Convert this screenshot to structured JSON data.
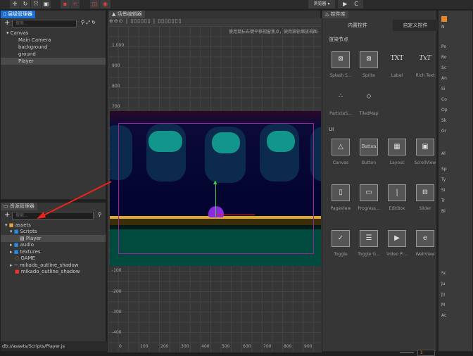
{
  "toolbar": {
    "tools": [
      "move-icon",
      "rotate-icon",
      "scale-icon",
      "rect-icon"
    ],
    "preview_target": "浏览器 ▾",
    "play": "▶",
    "refresh": "C"
  },
  "hierarchy": {
    "title": "层级管理器",
    "search_placeholder": "搜索...",
    "items": [
      {
        "label": "Canvas",
        "depth": 0,
        "expanded": true
      },
      {
        "label": "Main Camera",
        "depth": 1
      },
      {
        "label": "background",
        "depth": 1
      },
      {
        "label": "ground",
        "depth": 1
      },
      {
        "label": "Player",
        "depth": 1,
        "selected": true
      }
    ]
  },
  "assets": {
    "title": "资源管理器",
    "search_placeholder": "搜索...",
    "items": [
      {
        "label": "assets",
        "icon": "db-icon"
      },
      {
        "label": "Scripts",
        "icon": "folder-icon"
      },
      {
        "label": "Player",
        "icon": "js-icon",
        "selected": true
      },
      {
        "label": "audio",
        "icon": "folder-icon"
      },
      {
        "label": "textures",
        "icon": "folder-icon"
      },
      {
        "label": "GAME",
        "icon": "scene-icon"
      },
      {
        "label": "mikado_outline_shadow",
        "icon": "font-icon"
      },
      {
        "label": "mikado_outline_shadow",
        "icon": "image-icon"
      }
    ],
    "status": "db://assets/Scripts/Player.js"
  },
  "scene": {
    "title": "场景编辑器",
    "hint": "使用鼠标右键平移视窗焦点，使用滚轮缩放视图",
    "y_ticks": [
      "1,000",
      "900",
      "800",
      "700",
      "-100",
      "-200",
      "-300",
      "-400"
    ],
    "x_ticks": [
      "0",
      "100",
      "200",
      "300",
      "400",
      "500",
      "600",
      "700",
      "800",
      "900"
    ]
  },
  "widgets": {
    "title": "控件库",
    "tabs": [
      "内置控件",
      "自定义控件"
    ],
    "section_render": "渲染节点",
    "render": [
      {
        "label": "Splash S...",
        "icon": "splash-icon"
      },
      {
        "label": "Sprite",
        "icon": "sprite-icon"
      },
      {
        "label": "Label",
        "icon": "TXT"
      },
      {
        "label": "Rich Text",
        "icon": "TxT"
      },
      {
        "label": "ParticleS...",
        "icon": "particle-icon"
      },
      {
        "label": "TiledMap",
        "icon": "tiledmap-icon"
      }
    ],
    "section_ui": "UI",
    "ui": [
      {
        "label": "Canvas",
        "icon": "△"
      },
      {
        "label": "Button",
        "icon": "Button"
      },
      {
        "label": "Layout",
        "icon": "▦"
      },
      {
        "label": "ScrollView",
        "icon": "▣"
      },
      {
        "label": "PageView",
        "icon": "▯"
      },
      {
        "label": "Progress...",
        "icon": "▭"
      },
      {
        "label": "EditBox",
        "icon": "|"
      },
      {
        "label": "Slider",
        "icon": "⊟"
      },
      {
        "label": "Toggle",
        "icon": "✓"
      },
      {
        "label": "Toggle G...",
        "icon": "☰"
      },
      {
        "label": "Video Pl...",
        "icon": "▶"
      },
      {
        "label": "WebView",
        "icon": "e"
      }
    ],
    "zoom_value": "1"
  },
  "inspector": {
    "labels": [
      "N",
      "Po",
      "Ro",
      "Sc",
      "An",
      "Si",
      "Co",
      "Op",
      "Sk",
      "Gr",
      "Al",
      "Sp",
      "Ty",
      "Si",
      "Tr",
      "Bl",
      "Sc",
      "Ju",
      "Ju",
      "M",
      "Ac"
    ]
  }
}
